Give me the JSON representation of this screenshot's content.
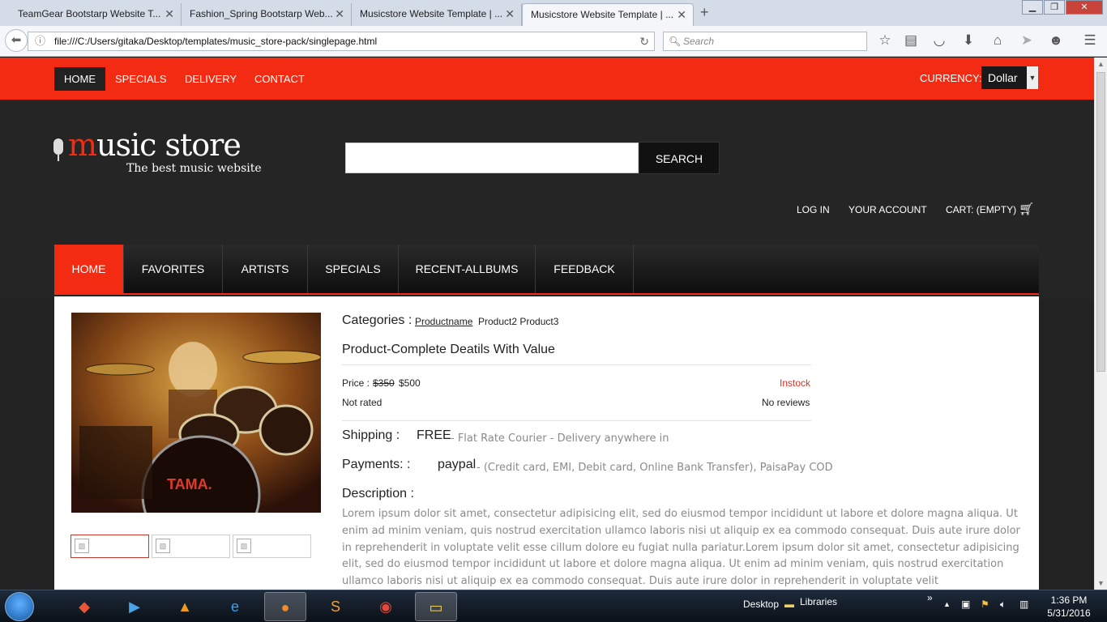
{
  "browser": {
    "tabs": [
      {
        "title": "TeamGear Bootstarp Website T...",
        "active": false
      },
      {
        "title": "Fashion_Spring Bootstarp Web...",
        "active": false
      },
      {
        "title": "Musicstore Website Template | ...",
        "active": false
      },
      {
        "title": "Musicstore Website Template | ...",
        "active": true
      }
    ],
    "new_tab": "+",
    "url": "file:///C:/Users/gitaka/Desktop/templates/music_store-pack/singlepage.html",
    "search_placeholder": "Search"
  },
  "page": {
    "topnav": [
      "HOME",
      "SPECIALS",
      "DELIVERY",
      "CONTACT"
    ],
    "currency_label": "CURRENCY:",
    "currency_value": "Dollar",
    "logo_prefix": "m",
    "logo_rest": "usic store",
    "logo_tagline": "The best music website",
    "search_button": "SEARCH",
    "account_links": {
      "login": "LOG IN",
      "account": "YOUR ACCOUNT",
      "cart": "CART: (EMPTY)"
    },
    "mainnav": [
      "HOME",
      "FAVORITES",
      "ARTISTS",
      "SPECIALS",
      "RECENT-ALLBUMS",
      "FEEDBACK"
    ],
    "product": {
      "categories_label": "Categories :",
      "category_link": "Productname",
      "category_others": "Product2 Product3",
      "title": "Product-Complete Deatils With Value",
      "price_label": "Price :",
      "old_price": "$350",
      "new_price": "$500",
      "stock": "Instock",
      "rating": "Not rated",
      "reviews": "No reviews",
      "shipping_label": "Shipping :",
      "shipping_value": "FREE",
      "shipping_desc": "- Flat Rate Courier - Delivery anywhere in",
      "payments_label": "Payments: :",
      "payments_value": "paypal",
      "payments_desc": "- (Credit card, EMI, Debit card, Online Bank Transfer), PaisaPay COD",
      "description_label": "Description :",
      "description": "Lorem ipsum dolor sit amet, consectetur adipisicing elit, sed do eiusmod tempor incididunt ut labore et dolore magna aliqua. Ut enim ad minim veniam, quis nostrud exercitation ullamco laboris nisi ut aliquip ex ea commodo consequat. Duis aute irure dolor in reprehenderit in voluptate velit esse cillum dolore eu fugiat nulla pariatur.Lorem ipsum dolor sit amet, consectetur adipisicing elit, sed do eiusmod tempor incididunt ut labore et dolore magna aliqua. Ut enim ad minim veniam, quis nostrud exercitation ullamco laboris nisi ut aliquip ex ea commodo consequat. Duis aute irure dolor in reprehenderit in voluptate velit"
    }
  },
  "taskbar": {
    "desktop_label": "Desktop",
    "libraries_label": "Libraries",
    "time": "1:36 PM",
    "date": "5/31/2016"
  },
  "colors": {
    "accent": "#f42b13",
    "dark": "#222222"
  }
}
